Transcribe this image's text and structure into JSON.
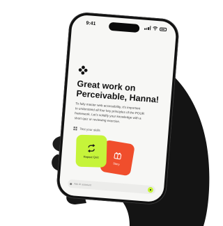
{
  "status_bar": {
    "time": "9:41"
  },
  "heading": {
    "lines": [
      "Great work on",
      "Perceivable, Hanna!"
    ]
  },
  "description": {
    "lines": [
      "To fully master web accessibility, it's important",
      "to understand all four key principles of the POUR",
      "framework. Let's solidify your knowledge with a",
      "short quiz or reviewing exercise."
    ]
  },
  "skills_link": {
    "label": "Test your skills"
  },
  "cards": {
    "green": {
      "label": "Repeat Quiz",
      "icon": "repeat-icon",
      "color": "#c6f43a"
    },
    "red": {
      "label": "Story",
      "icon": "gift-icon",
      "color": "#f04e2c"
    }
  },
  "bottom_bar": {
    "text": "Ask AI assistant"
  }
}
